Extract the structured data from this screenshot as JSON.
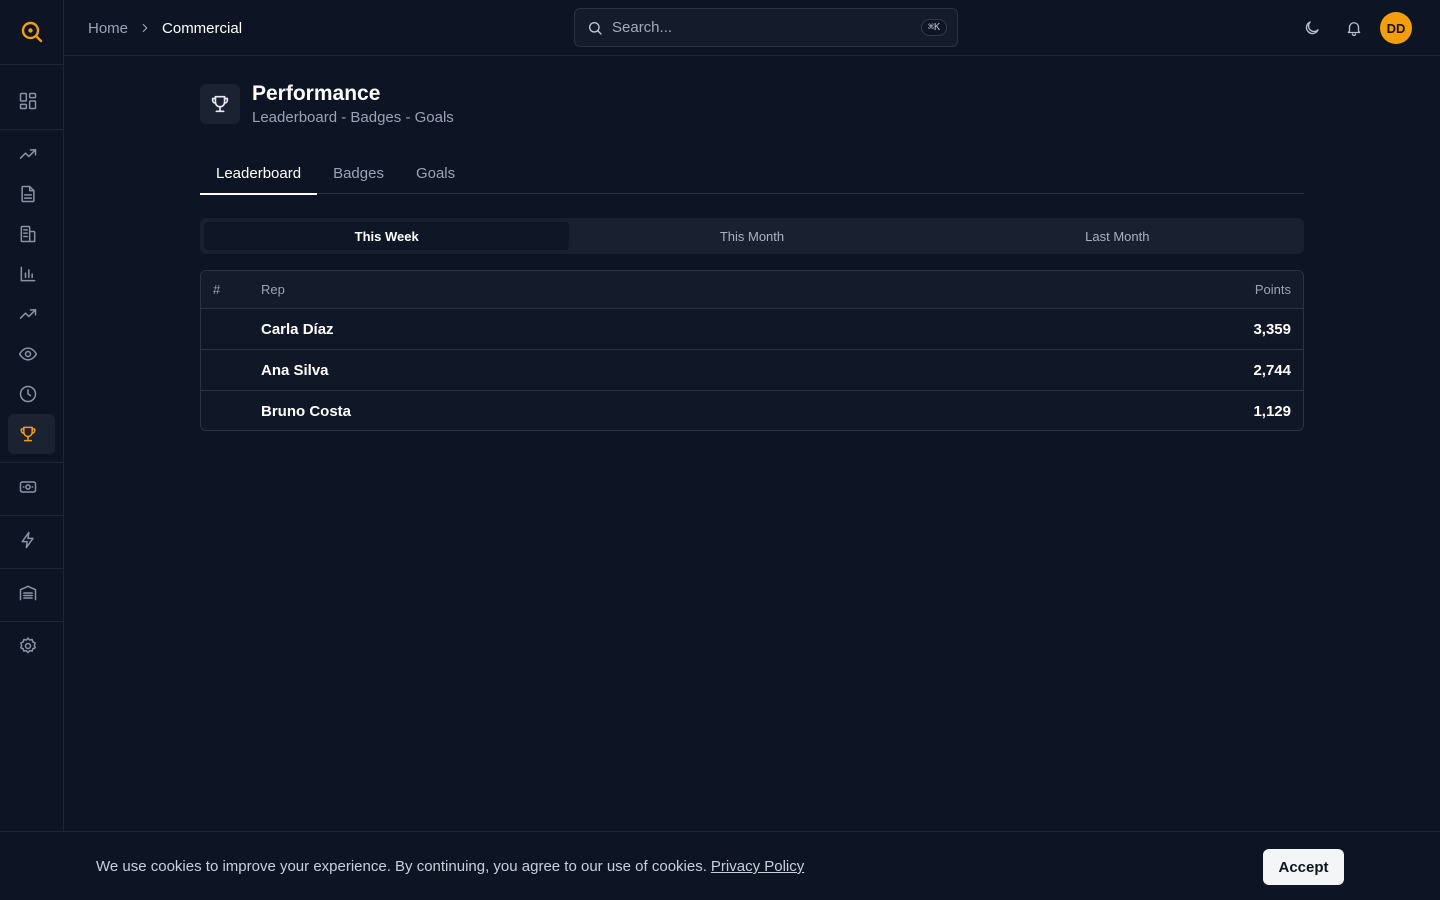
{
  "header": {
    "breadcrumb": {
      "home": "Home",
      "current": "Commercial"
    },
    "search": {
      "placeholder": "Search...",
      "shortcut": "⌘K"
    },
    "avatar_initials": "DD"
  },
  "page": {
    "title": "Performance",
    "subtitle": "Leaderboard - Badges - Goals",
    "tabs": [
      {
        "label": "Leaderboard",
        "active": true
      },
      {
        "label": "Badges",
        "active": false
      },
      {
        "label": "Goals",
        "active": false
      }
    ],
    "periods": [
      {
        "label": "This Week",
        "active": true
      },
      {
        "label": "This Month",
        "active": false
      },
      {
        "label": "Last Month",
        "active": false
      }
    ]
  },
  "leaderboard": {
    "columns": {
      "rank": "#",
      "rep": "Rep",
      "points": "Points"
    },
    "rows": [
      {
        "rank": "",
        "rep": "Carla Díaz",
        "points": "3,359"
      },
      {
        "rank": "",
        "rep": "Ana Silva",
        "points": "2,744"
      },
      {
        "rank": "",
        "rep": "Bruno Costa",
        "points": "1,129"
      }
    ]
  },
  "cookie": {
    "text": "We use cookies to improve your experience. By continuing, you agree to our use of cookies.",
    "link": "Privacy Policy",
    "accept": "Accept"
  },
  "colors": {
    "accent": "#f59e0b",
    "background": "#0d1424"
  },
  "icons": {
    "sidebar": [
      "dashboard-icon",
      "trending-up-icon",
      "document-icon",
      "building-icon",
      "bar-chart-icon",
      "trending-up-icon",
      "eye-icon",
      "clock-icon",
      "trophy-icon",
      "cash-icon",
      "lightning-icon",
      "warehouse-icon",
      "settings-icon"
    ]
  }
}
